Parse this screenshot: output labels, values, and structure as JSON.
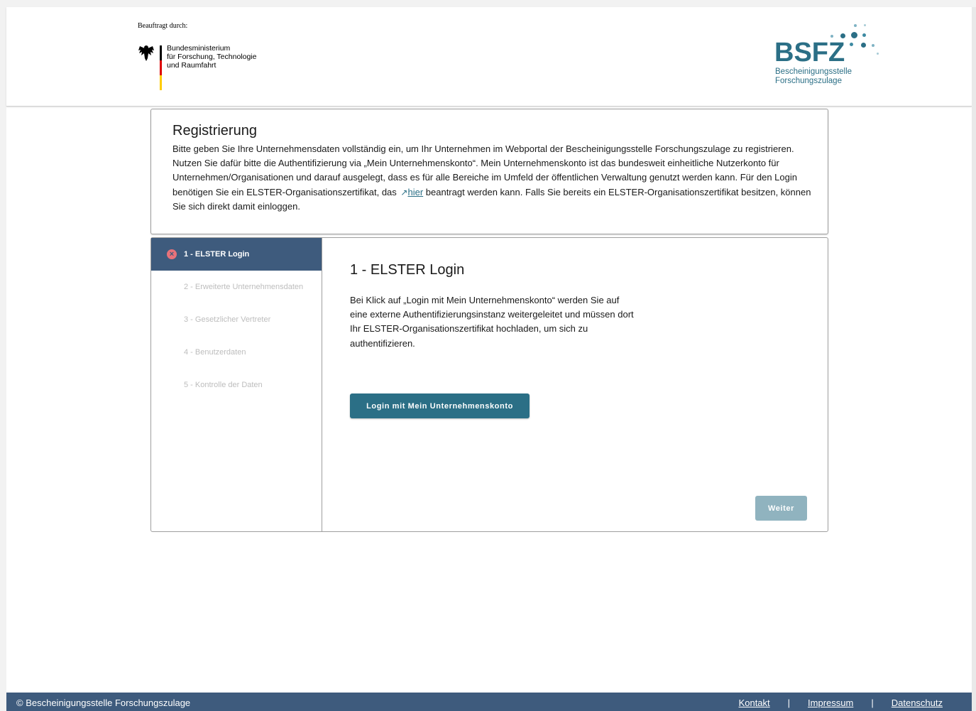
{
  "header": {
    "commissioned_by": "Beauftragt durch:",
    "ministry_lines": [
      "Bundesministerium",
      "für Forschung, Technologie",
      "und Raumfahrt"
    ],
    "logo_word": "BSFZ",
    "logo_subtitle_lines": [
      "Bescheinigungsstelle",
      "Forschungszulage"
    ],
    "brand_color": "#2b6f86"
  },
  "intro": {
    "title": "Registrierung",
    "text_before_link": "Bitte geben Sie Ihre Unternehmensdaten vollständig ein, um Ihr Unternehmen im Webportal der Bescheinigungsstelle Forschungszulage zu registrieren. Nutzen Sie dafür bitte die Authentifizierung via „Mein Unternehmenskonto“. Mein Unternehmenskonto ist das bundesweit einheitliche Nutzerkonto für Unternehmen/Organisationen und darauf ausgelegt, dass es für alle Bereiche im Umfeld der öffentlichen Verwaltung genutzt werden kann. Für den Login benötigen Sie ein ELSTER-Organisationszertifikat, das",
    "link_icon": "↗",
    "link_text": "hier",
    "text_after_link": " beantragt werden kann. Falls Sie bereits ein ELSTER-Organisationszertifikat besitzen, können Sie sich direkt damit einloggen."
  },
  "steps": [
    {
      "label": "1 - ELSTER Login",
      "state": "active-error"
    },
    {
      "label": "2 - Erweiterte Unternehmensdaten",
      "state": "disabled"
    },
    {
      "label": "3 - Gesetzlicher Vertreter",
      "state": "disabled"
    },
    {
      "label": "4 - Benutzerdaten",
      "state": "disabled"
    },
    {
      "label": "5 - Kontrolle der Daten",
      "state": "disabled"
    }
  ],
  "content": {
    "title": "1 - ELSTER Login",
    "description": "Bei Klick auf „Login mit Mein Unternehmenskonto“ werden Sie auf eine externe Authentifizierungsinstanz weitergeleitet und müssen dort Ihr ELSTER-Organisationszertifikat hochladen, um sich zu authentifizieren.",
    "login_button": "Login mit Mein Unternehmenskonto",
    "next_button": "Weiter"
  },
  "footer": {
    "copyright": "© Bescheinigungsstelle Forschungszulage",
    "links": [
      "Kontakt",
      "Impressum",
      "Datenschutz"
    ],
    "separator": "|"
  },
  "icons": {
    "step_error": "error-circle-icon",
    "external_link": "external-link-icon",
    "eagle": "federal-eagle-icon"
  }
}
